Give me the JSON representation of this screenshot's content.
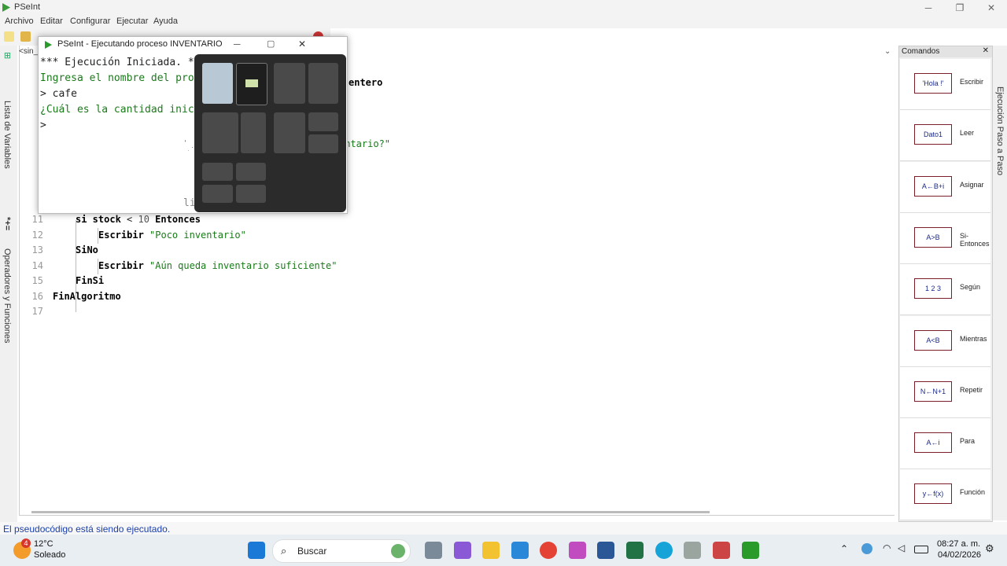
{
  "app": {
    "title": "PSeInt"
  },
  "menu": [
    "Archivo",
    "Editar",
    "Configurar",
    "Ejecutar",
    "Ayuda"
  ],
  "editor": {
    "file_tab": "<sin_",
    "lines": [
      {
        "n": "11",
        "indent": 2,
        "segments": [
          {
            "t": "si stock ",
            "c": "kw"
          },
          {
            "t": "< ",
            "c": "plain"
          },
          {
            "t": "10 ",
            "c": "num"
          },
          {
            "t": "Entonces",
            "c": "kw"
          }
        ]
      },
      {
        "n": "12",
        "indent": 3,
        "segments": [
          {
            "t": "Escribir ",
            "c": "kw"
          },
          {
            "t": "\"Poco inventario\"",
            "c": "str"
          }
        ]
      },
      {
        "n": "13",
        "indent": 2,
        "segments": [
          {
            "t": "SiNo",
            "c": "kw"
          }
        ]
      },
      {
        "n": "14",
        "indent": 3,
        "segments": [
          {
            "t": "Escribir ",
            "c": "kw"
          },
          {
            "t": "\"Aún queda inventario suficiente\"",
            "c": "str"
          }
        ]
      },
      {
        "n": "15",
        "indent": 2,
        "segments": [
          {
            "t": "FinSi",
            "c": "kw"
          }
        ]
      },
      {
        "n": "16",
        "indent": 1,
        "segments": [
          {
            "t": "FinAlgoritmo",
            "c": "kw"
          }
        ]
      },
      {
        "n": "17",
        "indent": 1,
        "segments": []
      }
    ],
    "partial_right": {
      "entero": "entero",
      "inventario": "entario?\""
    }
  },
  "left_tabs": [
    "Lista de Variables",
    "Operadores y Funciones"
  ],
  "commands": {
    "header": "Comandos",
    "items": [
      {
        "label": "Escribir",
        "glyph": "'Hola !'"
      },
      {
        "label": "Leer",
        "glyph": "Dato1"
      },
      {
        "label": "Asignar",
        "glyph": "A←B+i"
      },
      {
        "label": "Si-Entonces",
        "glyph": "A>B"
      },
      {
        "label": "Según",
        "glyph": "1 2 3"
      },
      {
        "label": "Mientras",
        "glyph": "A<B"
      },
      {
        "label": "Repetir",
        "glyph": "N←N+1"
      },
      {
        "label": "Para",
        "glyph": "A←i"
      },
      {
        "label": "Función",
        "glyph": "y←f(x)"
      }
    ]
  },
  "right_tab": "Ejecución Paso a Paso",
  "console": {
    "title": "PSeInt - Ejecutando proceso INVENTARIO",
    "lines": [
      {
        "text": "*** Ejecución Iniciada. ***",
        "color": "#222222"
      },
      {
        "text": "Ingresa el nombre del produ",
        "color": "#1a7a1a"
      },
      {
        "text": "> cafe",
        "color": "#222222"
      },
      {
        "text": "¿Cuál es la cantidad inicia",
        "color": "#1a7a1a"
      },
      {
        "text": ">",
        "color": "#222222"
      }
    ],
    "partial": "li"
  },
  "status": "El pseudocódigo está siendo ejecutado.",
  "taskbar": {
    "weather_temp": "12°C",
    "weather_desc": "Soleado",
    "weather_badge": "4",
    "search_placeholder": "Buscar",
    "time": "08:27 a. m.",
    "date": "04/02/2026"
  }
}
